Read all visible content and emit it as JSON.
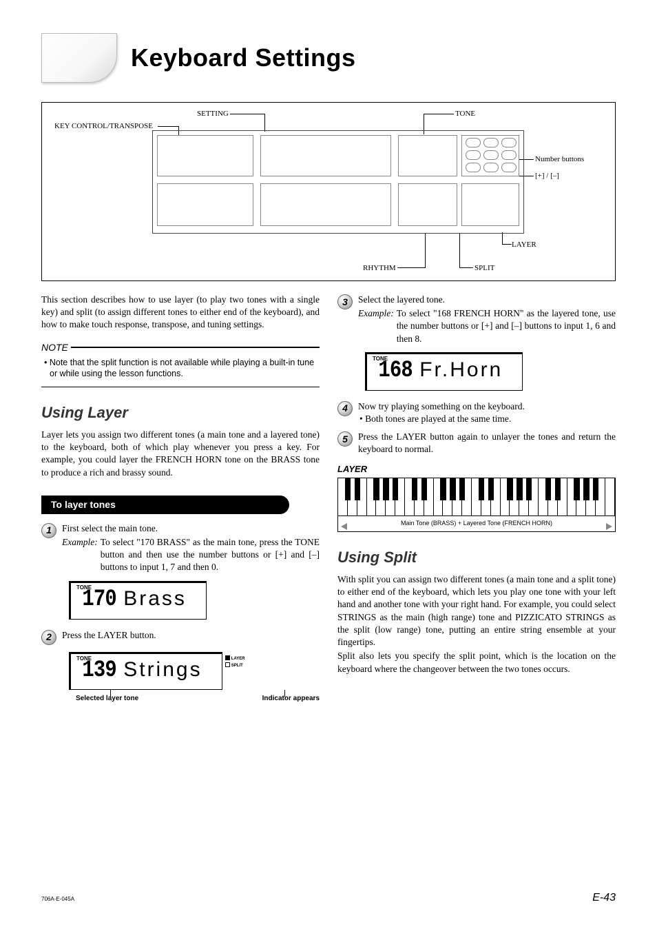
{
  "title": "Keyboard Settings",
  "diagram": {
    "label_setting": "SETTING",
    "label_tone": "TONE",
    "label_key_control": "KEY CONTROL/TRANSPOSE",
    "label_number_buttons": "Number buttons",
    "label_plus_minus": "[+] / [–]",
    "label_rhythm": "RHYTHM",
    "label_layer": "LAYER",
    "label_split": "SPLIT"
  },
  "intro": "This section describes how to use layer (to play two tones with a single key) and split (to assign different tones to either end of the keyboard), and how to make touch response, transpose, and tuning settings.",
  "note": {
    "heading": "NOTE",
    "body_bullet": "• Note that the split function is not available while playing a built-in tune or while using the lesson functions."
  },
  "using_layer": {
    "heading": "Using Layer",
    "intro": "Layer lets you assign two different tones (a main tone and a layered tone) to the keyboard, both of which play whenever you press a key. For example, you could layer the FRENCH HORN tone on the BRASS tone to produce a rich and brassy sound.",
    "pill": "To layer tones",
    "steps": {
      "s1": {
        "num": "1",
        "text": "First select the main tone.",
        "example_label": "Example:",
        "example_text": "To select \"170 BRASS\" as the main tone, press the TONE button and then use the number buttons or [+] and [–] buttons to input 1, 7 and then 0."
      },
      "s2": {
        "num": "2",
        "text": "Press the LAYER button."
      },
      "s3": {
        "num": "3",
        "text": "Select the layered tone.",
        "example_label": "Example:",
        "example_text": "To select \"168 FRENCH HORN\" as the layered tone, use the number buttons or [+] and [–] buttons to input 1, 6 and then 8."
      },
      "s4": {
        "num": "4",
        "text": "Now try playing something on the keyboard.",
        "bullet": "• Both tones are played at the same time."
      },
      "s5": {
        "num": "5",
        "text": "Press the LAYER button again to unlayer the tones and return the keyboard to normal."
      }
    }
  },
  "lcd": {
    "badge": "TONE",
    "brass_num": "170",
    "brass_name": "Brass",
    "strings_num": "139",
    "strings_name": "Strings",
    "strings_callout_left": "Selected layer tone",
    "strings_callout_right": "Indicator appears",
    "strings_ind_1": "LAYER",
    "strings_ind_2": "SPLIT",
    "horn_num": "168",
    "horn_name": "Fr.Horn"
  },
  "layer_figure": {
    "title": "LAYER",
    "caption": "Main Tone (BRASS) + Layered Tone (FRENCH HORN)"
  },
  "using_split": {
    "heading": "Using Split",
    "p1": "With split you can assign two different tones (a main tone and a split tone) to either end of the keyboard, which lets you play one tone with your left hand and another tone with your right hand. For example, you could select STRINGS as the main (high range) tone and PIZZICATO STRINGS as the split (low range) tone, putting an entire string ensemble at your fingertips.",
    "p2": "Split also lets you specify the split point, which is the location on the keyboard where the changeover between the two tones occurs."
  },
  "footer": {
    "doc_id": "706A-E-045A",
    "page": "E-43"
  }
}
